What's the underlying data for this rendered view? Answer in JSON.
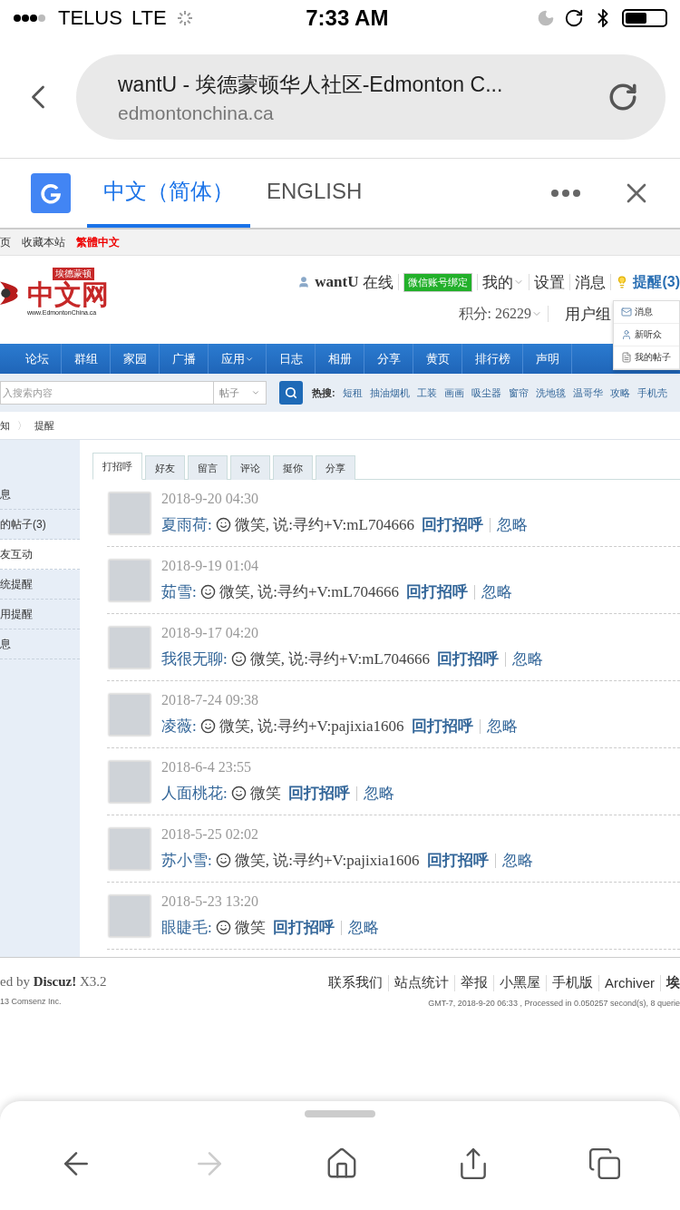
{
  "status_bar": {
    "carrier": "TELUS",
    "network": "LTE",
    "time": "7:33 AM"
  },
  "address_bar": {
    "title": "wantU - 埃德蒙顿华人社区-Edmonton C...",
    "url": "edmontonchina.ca"
  },
  "translate_bar": {
    "languages": [
      {
        "label": "中文（简体）",
        "selected": true
      },
      {
        "label": "ENGLISH",
        "selected": false
      }
    ]
  },
  "site": {
    "top_links": [
      {
        "label": "页",
        "kind": "plain"
      },
      {
        "label": "收藏本站",
        "kind": "plain"
      },
      {
        "label": "繁體中文",
        "kind": "highlight"
      }
    ],
    "logo": {
      "tagline": "埃德蒙顿",
      "name": "中文网",
      "url": "www.EdmontonChina.ca"
    },
    "user": {
      "name": "wantU",
      "status": "在线",
      "wechat": "微信账号绑定",
      "links": [
        {
          "label": "我的",
          "dropdown": true
        },
        {
          "label": "设置",
          "dropdown": false
        },
        {
          "label": "消息",
          "dropdown": false
        }
      ],
      "alerts": "提醒(3)",
      "points": "积分: 26229",
      "group": "用户组"
    },
    "alert_menu": [
      {
        "label": "消息",
        "kind": "mail"
      },
      {
        "label": "新听众",
        "kind": "user"
      },
      {
        "label": "我的帖子",
        "kind": "post"
      }
    ],
    "nav": [
      {
        "label": "论坛",
        "dropdown": false
      },
      {
        "label": "群组",
        "dropdown": false
      },
      {
        "label": "家园",
        "dropdown": false
      },
      {
        "label": "广播",
        "dropdown": false
      },
      {
        "label": "应用",
        "dropdown": true
      },
      {
        "label": "日志",
        "dropdown": false
      },
      {
        "label": "相册",
        "dropdown": false
      },
      {
        "label": "分享",
        "dropdown": false
      },
      {
        "label": "黄页",
        "dropdown": false
      },
      {
        "label": "排行榜",
        "dropdown": false
      },
      {
        "label": "声明",
        "dropdown": false
      }
    ],
    "search": {
      "placeholder": "入搜索内容",
      "scope": "帖子",
      "hot_label": "热搜:",
      "hot": [
        "短租",
        "抽油烟机",
        "工装",
        "画画",
        "吸尘器",
        "窗帘",
        "洗地毯",
        "温哥华",
        "攻略",
        "手机壳"
      ]
    },
    "breadcrumb": [
      "知",
      "提醒"
    ],
    "breadcrumb_separator": "〉",
    "sidebar": [
      {
        "label": "息",
        "selected": false
      },
      {
        "label": "的帖子(3)",
        "selected": false
      },
      {
        "label": "友互动",
        "selected": true
      },
      {
        "label": "统提醒",
        "selected": false
      },
      {
        "label": "用提醒",
        "selected": false
      },
      {
        "label": "息",
        "selected": false
      }
    ],
    "tabs": [
      {
        "label": "打招呼",
        "selected": true
      },
      {
        "label": "好友",
        "selected": false
      },
      {
        "label": "留言",
        "selected": false
      },
      {
        "label": "评论",
        "selected": false
      },
      {
        "label": "挺你",
        "selected": false
      },
      {
        "label": "分享",
        "selected": false
      }
    ],
    "notifications": [
      {
        "time": "2018-9-20 04:30",
        "name": "夏雨荷:",
        "message": "微笑, 说:寻约+V:mL704666",
        "reply": "回打招呼",
        "ignore": "忽略"
      },
      {
        "time": "2018-9-19 01:04",
        "name": "茹雪:",
        "message": "微笑, 说:寻约+V:mL704666",
        "reply": "回打招呼",
        "ignore": "忽略"
      },
      {
        "time": "2018-9-17 04:20",
        "name": "我很无聊:",
        "message": "微笑, 说:寻约+V:mL704666",
        "reply": "回打招呼",
        "ignore": "忽略"
      },
      {
        "time": "2018-7-24 09:38",
        "name": "凌薇:",
        "message": "微笑, 说:寻约+V:pajixia1606",
        "reply": "回打招呼",
        "ignore": "忽略"
      },
      {
        "time": "2018-6-4 23:55",
        "name": "人面桃花:",
        "message": "微笑",
        "reply": "回打招呼",
        "ignore": "忽略"
      },
      {
        "time": "2018-5-25 02:02",
        "name": "苏小雪:",
        "message": "微笑, 说:寻约+V:pajixia1606",
        "reply": "回打招呼",
        "ignore": "忽略"
      },
      {
        "time": "2018-5-23 13:20",
        "name": "眼睫毛:",
        "message": "微笑",
        "reply": "回打招呼",
        "ignore": "忽略"
      }
    ],
    "footer": {
      "powered": "ed by **Discuz!** X3.2",
      "copyright": "13 Comsenz Inc.",
      "links": [
        "联系我们",
        "站点统计",
        "举报",
        "小黑屋",
        "手机版",
        "Archiver",
        "埃"
      ],
      "info": "GMT-7, 2018-9-20 06:33 , Processed in 0.050257 second(s), 8 querie"
    }
  },
  "toolbar": {
    "forward_disabled": true
  }
}
